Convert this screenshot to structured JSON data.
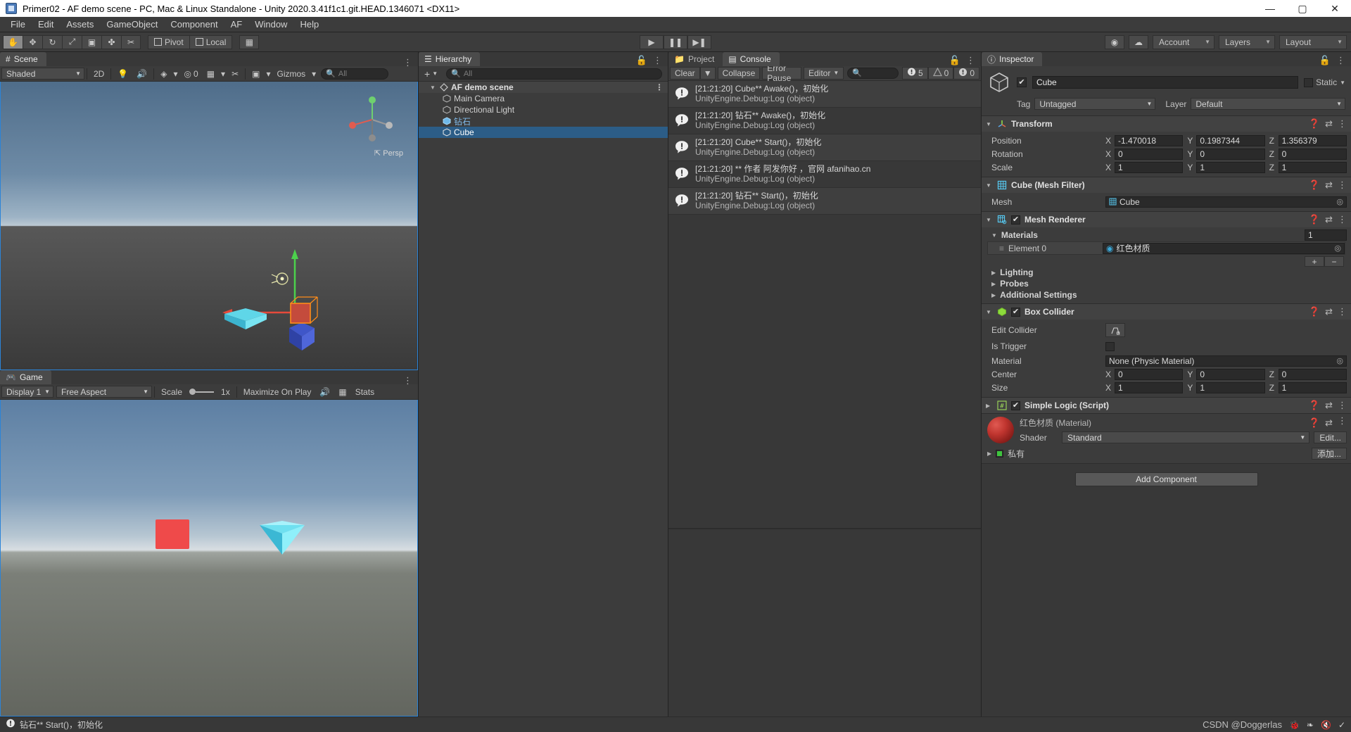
{
  "window": {
    "title": "Primer02 - AF demo scene - PC, Mac & Linux Standalone - Unity 2020.3.41f1c1.git.HEAD.1346071 <DX11>",
    "minimize": "—",
    "maximize": "▢",
    "close": "✕"
  },
  "menubar": {
    "items": [
      "File",
      "Edit",
      "Assets",
      "GameObject",
      "Component",
      "AF",
      "Window",
      "Help"
    ]
  },
  "toolbar": {
    "tools": [
      {
        "name": "hand-tool",
        "glyph": "✋"
      },
      {
        "name": "move-tool",
        "glyph": "✥"
      },
      {
        "name": "rotate-tool",
        "glyph": "↻"
      },
      {
        "name": "scale-tool",
        "glyph": "⤢"
      },
      {
        "name": "rect-tool",
        "glyph": "▣"
      },
      {
        "name": "transform-tool",
        "glyph": "✤"
      },
      {
        "name": "custom-tool",
        "glyph": "✂"
      }
    ],
    "pivot_label": "Pivot",
    "local_label": "Local",
    "grid_glyph": "▦",
    "play": "▶",
    "pause": "❚❚",
    "step": "▶❚",
    "collab_glyph": "◉",
    "cloud_glyph": "☁",
    "account_label": "Account",
    "layers_label": "Layers",
    "layout_label": "Layout"
  },
  "scene": {
    "tab_label": "Scene",
    "tab_icon": "scene-icon",
    "shading_mode": "Shaded",
    "two_d_label": "2D",
    "audio_count": "0",
    "gizmos_label": "Gizmos",
    "search_placeholder": "All",
    "persp_label": "Persp"
  },
  "game": {
    "tab_label": "Game",
    "display_label": "Display 1",
    "aspect_label": "Free Aspect",
    "scale_label": "Scale",
    "scale_value": "1x",
    "maximize_label": "Maximize On Play",
    "stats_label": "Stats"
  },
  "hierarchy": {
    "tab_label": "Hierarchy",
    "add_label": "+",
    "search_placeholder": "All",
    "items": [
      {
        "label": "AF demo scene",
        "type": "scene",
        "depth": 0,
        "selected": false,
        "icon": "unity-scene-icon"
      },
      {
        "label": "Main Camera",
        "type": "object",
        "depth": 1,
        "selected": false,
        "icon": "gameobject-icon"
      },
      {
        "label": "Directional Light",
        "type": "object",
        "depth": 1,
        "selected": false,
        "icon": "gameobject-icon"
      },
      {
        "label": "钻石",
        "type": "prefab",
        "depth": 1,
        "selected": false,
        "icon": "prefab-icon"
      },
      {
        "label": "Cube",
        "type": "object",
        "depth": 1,
        "selected": true,
        "icon": "gameobject-icon"
      }
    ]
  },
  "project_console": {
    "project_tab": "Project",
    "console_tab": "Console",
    "clear_label": "Clear",
    "collapse_label": "Collapse",
    "error_pause_label": "Error Pause",
    "editor_label": "Editor",
    "search_placeholder": "",
    "counts": {
      "log": "5",
      "warning": "0",
      "error": "0"
    },
    "messages": [
      {
        "line1": "[21:21:20] Cube** Awake()，初始化",
        "line2": "UnityEngine.Debug:Log (object)"
      },
      {
        "line1": "[21:21:20] 钻石** Awake()，初始化",
        "line2": "UnityEngine.Debug:Log (object)"
      },
      {
        "line1": "[21:21:20] Cube** Start()，初始化",
        "line2": "UnityEngine.Debug:Log (object)"
      },
      {
        "line1": "[21:21:20] ** 作者 阿发你好 ，官网 afanihao.cn",
        "line2": "UnityEngine.Debug:Log (object)"
      },
      {
        "line1": "[21:21:20] 钻石** Start()，初始化",
        "line2": "UnityEngine.Debug:Log (object)"
      }
    ]
  },
  "inspector": {
    "tab_label": "Inspector",
    "object_name": "Cube",
    "enabled": true,
    "static_label": "Static",
    "tag_label": "Tag",
    "tag_value": "Untagged",
    "layer_label": "Layer",
    "layer_value": "Default",
    "transform": {
      "title": "Transform",
      "rows": [
        {
          "label": "Position",
          "x": "-1.470018",
          "y": "0.1987344",
          "z": "1.356379"
        },
        {
          "label": "Rotation",
          "x": "0",
          "y": "0",
          "z": "0"
        },
        {
          "label": "Scale",
          "x": "1",
          "y": "1",
          "z": "1"
        }
      ]
    },
    "mesh_filter": {
      "title": "Cube (Mesh Filter)",
      "mesh_label": "Mesh",
      "mesh_value": "Cube"
    },
    "mesh_renderer": {
      "title": "Mesh Renderer",
      "enabled": true,
      "materials_label": "Materials",
      "materials_count": "1",
      "element_label": "Element 0",
      "element_value": "红色材质",
      "add_label": "+",
      "remove_label": "−",
      "foldouts": [
        "Lighting",
        "Probes",
        "Additional Settings"
      ]
    },
    "box_collider": {
      "title": "Box Collider",
      "enabled": true,
      "edit_collider_label": "Edit Collider",
      "is_trigger_label": "Is Trigger",
      "is_trigger_value": false,
      "material_label": "Material",
      "material_value": "None (Physic Material)",
      "center": {
        "label": "Center",
        "x": "0",
        "y": "0",
        "z": "0"
      },
      "size": {
        "label": "Size",
        "x": "1",
        "y": "1",
        "z": "1"
      }
    },
    "simple_logic": {
      "title": "Simple Logic (Script)",
      "enabled": true
    },
    "material_preview": {
      "title": "红色材质 (Material)",
      "shader_label": "Shader",
      "shader_value": "Standard",
      "edit_label": "Edit...",
      "private_label": "私有",
      "add_label": "添加...",
      "color": "#c0352f"
    },
    "add_component_label": "Add Component"
  },
  "statusbar": {
    "message": "钻石** Start()，初始化",
    "watermark": "CSDN @Doggerlas"
  }
}
